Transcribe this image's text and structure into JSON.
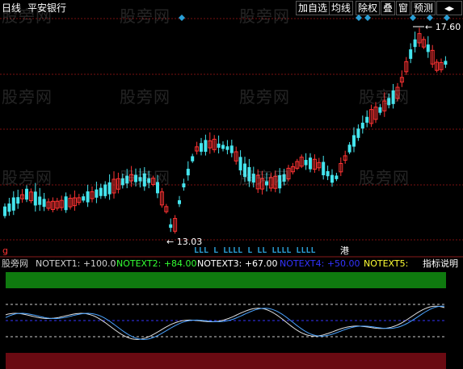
{
  "header": {
    "period": "日线",
    "stock": "平安银行",
    "buttons": [
      "加自选",
      "均线",
      "除权",
      "叠",
      "窗",
      "预测"
    ],
    "nav_icon": "arrow-left-right-icon"
  },
  "watermark": "股旁网",
  "price_chart": {
    "high_label": "17.60",
    "low_label": "13.03",
    "signal_text": "LLL L LLLL L LL LLLL LLLL",
    "signal_tag": "港",
    "corner_mark": "g"
  },
  "indicator_bar": {
    "name": "股旁网",
    "items": [
      {
        "label": "NOTEXT1: +100.0",
        "color": "#cfcfcf"
      },
      {
        "label": "NOTEXT2: +84.00",
        "color": "#33ff33"
      },
      {
        "label": "NOTEXT3: +67.00",
        "color": "#ffffff"
      },
      {
        "label": "NOTEXT4: +50.00",
        "color": "#3333ff"
      },
      {
        "label": "NOTEXT5:",
        "color": "#ffff33"
      }
    ],
    "help": "指标说明"
  },
  "colors": {
    "up": "#ff3333",
    "down": "#44e5ee",
    "grid": "#7a1010",
    "green_band": "#0f7a0f",
    "red_band": "#6a0a12",
    "accent": "#2a9fd6"
  }
}
